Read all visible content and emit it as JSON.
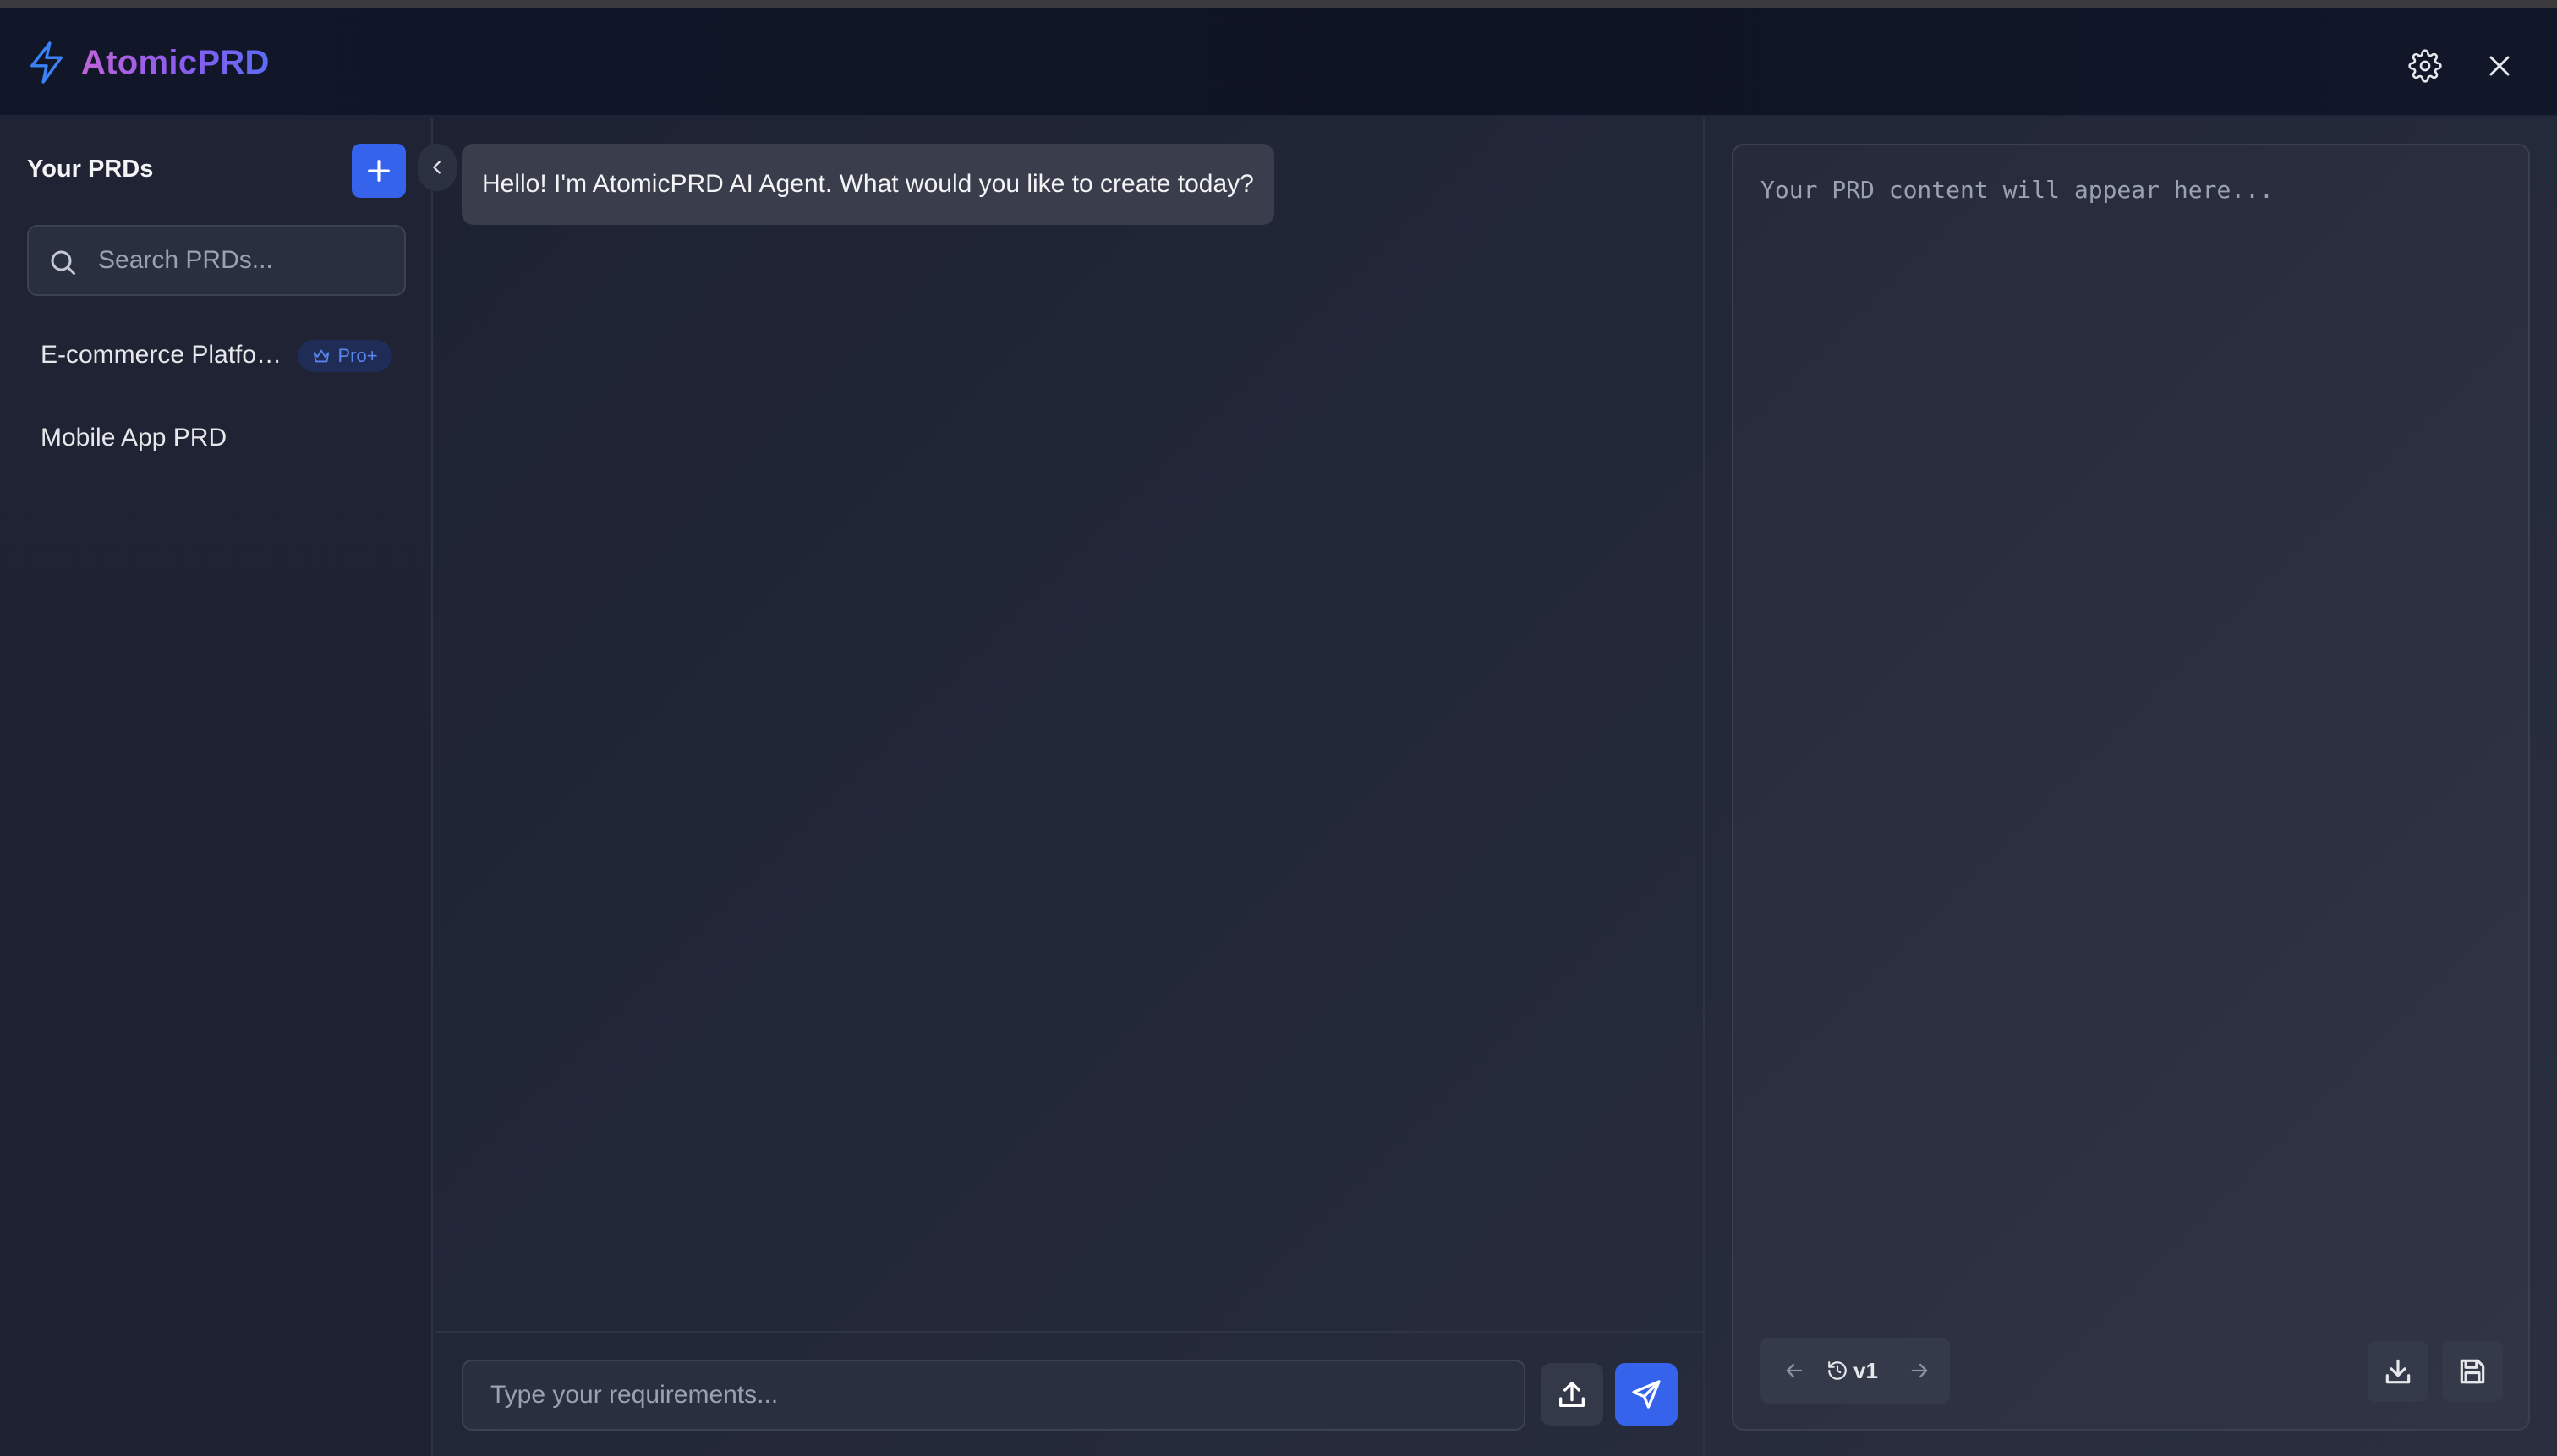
{
  "app": {
    "name": "AtomicPRD",
    "accent_color": "#3563eb",
    "brand_gradient": [
      "#c063d8",
      "#8a5cf0",
      "#5b6cf4"
    ]
  },
  "header": {
    "logo_icon": "lightning-icon",
    "settings_icon": "gear-icon",
    "close_icon": "close-icon"
  },
  "sidebar": {
    "title": "Your PRDs",
    "add_icon": "plus-icon",
    "search": {
      "placeholder": "Search PRDs...",
      "value": "",
      "icon": "search-icon"
    },
    "items": [
      {
        "label": "E-commerce Platfo…",
        "badge": "Pro+",
        "badge_icon": "crown-icon"
      },
      {
        "label": "Mobile App PRD"
      }
    ],
    "collapse_icon": "chevron-left-icon"
  },
  "chat": {
    "messages": [
      {
        "role": "assistant",
        "text": "Hello! I'm AtomicPRD AI Agent. What would you like to create today?"
      }
    ],
    "input": {
      "placeholder": "Type your requirements...",
      "value": ""
    },
    "upload_icon": "upload-icon",
    "send_icon": "send-icon"
  },
  "preview": {
    "placeholder": "Your PRD content will appear here...",
    "value": "",
    "version": {
      "label": "v1",
      "prev_icon": "arrow-left-icon",
      "history_icon": "history-icon",
      "next_icon": "arrow-right-icon"
    },
    "download_icon": "download-icon",
    "save_icon": "save-icon"
  }
}
